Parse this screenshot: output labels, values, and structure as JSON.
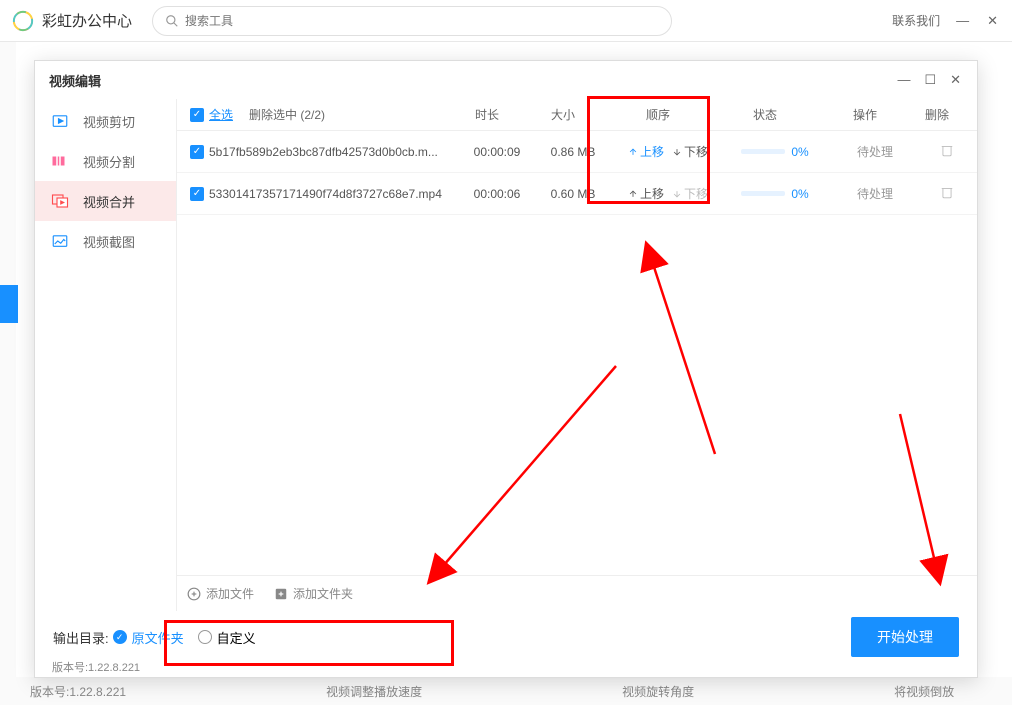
{
  "app": {
    "title": "彩虹办公中心",
    "search_placeholder": "搜索工具",
    "contact": "联系我们"
  },
  "modal": {
    "title": "视频编辑",
    "version": "版本号:1.22.8.221"
  },
  "sidebar": {
    "items": [
      {
        "label": "视频剪切"
      },
      {
        "label": "视频分割"
      },
      {
        "label": "视频合并"
      },
      {
        "label": "视频截图"
      }
    ]
  },
  "table": {
    "select_all": "全选",
    "remove_selected": "删除选中 (2/2)",
    "headers": {
      "duration": "时长",
      "size": "大小",
      "order": "顺序",
      "status": "状态",
      "action": "操作",
      "delete": "删除"
    },
    "move_up": "上移",
    "move_down": "下移",
    "rows": [
      {
        "name": "5b17fb589b2eb3bc87dfb42573d0b0cb.m...",
        "duration": "00:00:09",
        "size": "0.86 MB",
        "pct": "0%",
        "action": "待处理"
      },
      {
        "name": "53301417357171490f74d8f3727c68e7.mp4",
        "duration": "00:00:06",
        "size": "0.60 MB",
        "pct": "0%",
        "action": "待处理"
      }
    ]
  },
  "addbar": {
    "add_file": "添加文件",
    "add_folder": "添加文件夹"
  },
  "footer": {
    "output_label": "输出目录:",
    "radio_original": "原文件夹",
    "radio_custom": "自定义",
    "start": "开始处理"
  },
  "bg_footer": {
    "version": "版本号:1.22.8.221",
    "item1": "视频调整播放速度",
    "item2": "视频旋转角度",
    "item3": "将视频倒放"
  }
}
